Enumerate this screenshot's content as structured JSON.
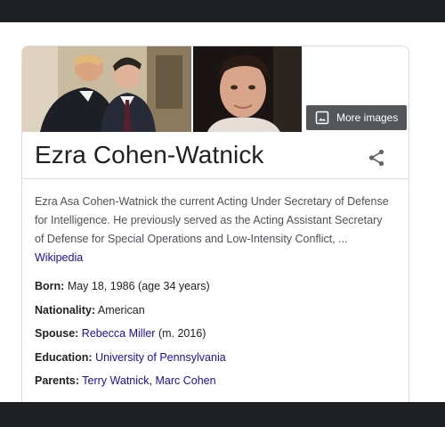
{
  "knowledge_panel": {
    "title": "Ezra Cohen-Watnick",
    "more_images_label": "More images",
    "description": {
      "text": "Ezra Asa Cohen-Watnick the current Acting Under Secretary of Defense for Intelligence. He previously served as the Acting Assistant Secretary of Defense for Special Operations and Low-Intensity Conflict, ...",
      "source_link": "Wikipedia"
    },
    "facts": {
      "born": {
        "label": "Born:",
        "value": "May 18, 1986 (age 34 years)"
      },
      "nationality": {
        "label": "Nationality:",
        "value": "American"
      },
      "spouse": {
        "label": "Spouse:",
        "link": "Rebecca Miller",
        "suffix": "(m. 2016)"
      },
      "education": {
        "label": "Education:",
        "link": "University of Pennsylvania"
      },
      "parents": {
        "label": "Parents:",
        "link1": "Terry Watnick",
        "separator": ",",
        "link2": "Marc Cohen"
      }
    }
  },
  "colors": {
    "frame_bar": "#1f2023",
    "link": "#1a0dab",
    "title_text": "#202124",
    "body_text": "#4d5156",
    "divider": "#dadce0"
  },
  "icons": [
    "image-icon",
    "share-icon"
  ]
}
